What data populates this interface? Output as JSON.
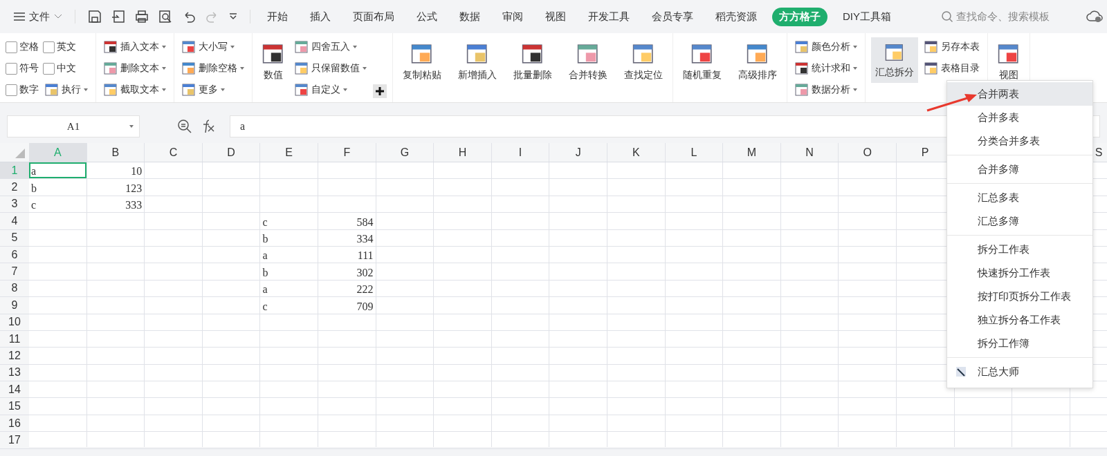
{
  "title_bar": {
    "file_menu": "文件",
    "tabs": [
      {
        "label": "开始",
        "selected": false
      },
      {
        "label": "插入",
        "selected": false
      },
      {
        "label": "页面布局",
        "selected": false
      },
      {
        "label": "公式",
        "selected": false
      },
      {
        "label": "数据",
        "selected": false
      },
      {
        "label": "审阅",
        "selected": false
      },
      {
        "label": "视图",
        "selected": false
      },
      {
        "label": "开发工具",
        "selected": false
      },
      {
        "label": "会员专享",
        "selected": false
      },
      {
        "label": "稻壳资源",
        "selected": false
      },
      {
        "label": "方方格子",
        "selected": true
      },
      {
        "label": "DIY工具箱",
        "selected": false
      }
    ],
    "search": {
      "placeholder": "查找命令、搜索模板"
    }
  },
  "ribbon": {
    "groups": [
      {
        "kind": "checks",
        "items": [
          {
            "label": "空格",
            "checked": false
          },
          {
            "label": "英文",
            "checked": false
          },
          {
            "label": "符号",
            "checked": false
          },
          {
            "label": "中文",
            "checked": false
          },
          {
            "label": "数字",
            "checked": false
          }
        ],
        "action": "执行"
      },
      {
        "kind": "small",
        "items": [
          "插入文本",
          "删除文本",
          "截取文本"
        ]
      },
      {
        "kind": "small",
        "items": [
          "大小写",
          "删除空格",
          "更多"
        ]
      },
      {
        "kind": "mixed",
        "large": [
          "数值"
        ],
        "items": [
          "四舍五入",
          "只保留数值",
          "自定义"
        ]
      },
      {
        "kind": "large",
        "large": [
          "复制粘贴",
          "新增插入",
          "批量删除",
          "合并转换",
          "查找定位"
        ]
      },
      {
        "kind": "large",
        "large": [
          "随机重复",
          "高级排序"
        ]
      },
      {
        "kind": "small",
        "items": [
          "颜色分析",
          "统计求和",
          "数据分析"
        ]
      },
      {
        "kind": "split",
        "large": [
          "汇总拆分"
        ],
        "expanded": true,
        "items": [
          "另存本表",
          "表格目录"
        ]
      },
      {
        "kind": "large",
        "large": [
          "视图"
        ]
      }
    ]
  },
  "formula_bar": {
    "name_box": "A1",
    "formula": "a"
  },
  "sheet": {
    "columns": [
      {
        "label": "A",
        "selected": true
      },
      {
        "label": "B",
        "selected": false
      },
      {
        "label": "C",
        "selected": false
      },
      {
        "label": "D",
        "selected": false
      },
      {
        "label": "E",
        "selected": false
      },
      {
        "label": "F",
        "selected": false
      },
      {
        "label": "G",
        "selected": false
      },
      {
        "label": "H",
        "selected": false
      },
      {
        "label": "I",
        "selected": false
      },
      {
        "label": "J",
        "selected": false
      },
      {
        "label": "K",
        "selected": false
      },
      {
        "label": "L",
        "selected": false
      },
      {
        "label": "M",
        "selected": false
      },
      {
        "label": "N",
        "selected": false
      },
      {
        "label": "O",
        "selected": false
      },
      {
        "label": "P",
        "selected": false
      },
      null,
      null,
      {
        "label": "S",
        "selected": false
      }
    ],
    "rows": [
      {
        "label": "1",
        "selected": true,
        "cells": [
          {
            "value": "a",
            "kind": "text",
            "selected": true
          },
          {
            "value": "10",
            "kind": "number",
            "selected": false
          }
        ]
      },
      {
        "label": "2",
        "selected": false,
        "cells": [
          {
            "value": "b",
            "kind": "text",
            "selected": false
          },
          {
            "value": "123",
            "kind": "number",
            "selected": false
          }
        ]
      },
      {
        "label": "3",
        "selected": false,
        "cells": [
          {
            "value": "c",
            "kind": "text",
            "selected": false
          },
          {
            "value": "333",
            "kind": "number",
            "selected": false
          }
        ]
      },
      {
        "label": "4",
        "selected": false,
        "cells": [
          null,
          null,
          null,
          null,
          {
            "value": "c",
            "kind": "text",
            "selected": false
          },
          {
            "value": "584",
            "kind": "number",
            "selected": false
          }
        ]
      },
      {
        "label": "5",
        "selected": false,
        "cells": [
          null,
          null,
          null,
          null,
          {
            "value": "b",
            "kind": "text",
            "selected": false
          },
          {
            "value": "334",
            "kind": "number",
            "selected": false
          }
        ]
      },
      {
        "label": "6",
        "selected": false,
        "cells": [
          null,
          null,
          null,
          null,
          {
            "value": "a",
            "kind": "text",
            "selected": false
          },
          {
            "value": "111",
            "kind": "number",
            "selected": false
          }
        ]
      },
      {
        "label": "7",
        "selected": false,
        "cells": [
          null,
          null,
          null,
          null,
          {
            "value": "b",
            "kind": "text",
            "selected": false
          },
          {
            "value": "302",
            "kind": "number",
            "selected": false
          }
        ]
      },
      {
        "label": "8",
        "selected": false,
        "cells": [
          null,
          null,
          null,
          null,
          {
            "value": "a",
            "kind": "text",
            "selected": false
          },
          {
            "value": "222",
            "kind": "number",
            "selected": false
          }
        ]
      },
      {
        "label": "9",
        "selected": false,
        "cells": [
          null,
          null,
          null,
          null,
          {
            "value": "c",
            "kind": "text",
            "selected": false
          },
          {
            "value": "709",
            "kind": "number",
            "selected": false
          }
        ]
      },
      {
        "label": "10",
        "selected": false
      },
      {
        "label": "11",
        "selected": false
      },
      {
        "label": "12",
        "selected": false
      },
      {
        "label": "13",
        "selected": false
      },
      {
        "label": "14",
        "selected": false
      },
      {
        "label": "15",
        "selected": false
      },
      {
        "label": "16",
        "selected": false
      },
      {
        "label": "17",
        "selected": false
      }
    ]
  },
  "dropdown_menu": {
    "sections": [
      [
        {
          "label": "合并两表",
          "selected": true
        },
        {
          "label": "合并多表",
          "selected": false
        },
        {
          "label": "分类合并多表",
          "selected": false
        }
      ],
      [
        {
          "label": "合并多簿",
          "selected": false
        }
      ],
      [
        {
          "label": "汇总多表",
          "selected": false
        },
        {
          "label": "汇总多簿",
          "selected": false
        }
      ],
      [
        {
          "label": "拆分工作表",
          "selected": false
        },
        {
          "label": "快速拆分工作表",
          "selected": false
        },
        {
          "label": "按打印页拆分工作表",
          "selected": false
        },
        {
          "label": "独立拆分各工作表",
          "selected": false
        },
        {
          "label": "拆分工作簿",
          "selected": false
        }
      ],
      [
        {
          "label": "汇总大师",
          "selected": false,
          "kind": "icon"
        }
      ]
    ]
  }
}
